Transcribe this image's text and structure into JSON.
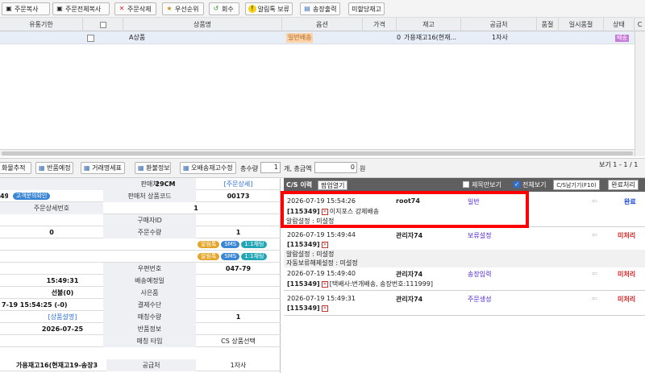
{
  "toolbar": {
    "buttons": [
      {
        "label": "주문복사",
        "icon": "copy-icon"
      },
      {
        "label": "주문전체복사",
        "icon": "copy-all-icon"
      },
      {
        "label": "주문삭제",
        "icon": "delete-icon"
      },
      {
        "label": "우선순위",
        "icon": "priority-icon"
      },
      {
        "label": "회수",
        "icon": "recall-icon"
      },
      {
        "label": "알림톡 보류",
        "icon": "alert-icon"
      },
      {
        "label": "송장출력",
        "icon": "print-icon"
      },
      {
        "label": "미할당재고",
        "icon": ""
      }
    ]
  },
  "grid": {
    "headers": [
      "유통기한",
      "",
      "상품명",
      "옵션",
      "가격",
      "재고",
      "공급처",
      "품절",
      "일시품절",
      "상태",
      "C"
    ],
    "row": {
      "product": "A상품",
      "option": "일반배송",
      "price": "",
      "stock": "0",
      "stock_name": "가용재고16(현재...",
      "supplier": "1자사",
      "status": "배송"
    }
  },
  "lowerbar": {
    "buttons": [
      "화물추적",
      "반품예정",
      "거래명세표",
      "환불정보",
      "오배송재고수정"
    ],
    "total_qty_label": "총수량",
    "total_qty": "1",
    "count_label": "개, 총금액",
    "total_amount": "0",
    "won": "원",
    "paging": "보기 1 - 1 / 1"
  },
  "detail": {
    "rows": [
      {
        "l2": "판매처",
        "v2": "29CM",
        "l3": "",
        "v3": "[주문상세]"
      },
      {
        "v1": "49",
        "chip1": "고객문의확인",
        "l2": "판매처 상품코드",
        "v3": "00173"
      },
      {
        "l1": "주문상세번호",
        "v3": "1"
      },
      {
        "l2": "구매자ID"
      },
      {
        "v1": "0",
        "l2": "주문수량",
        "v3": "1"
      },
      {
        "chips": [
          "알림톡",
          "SMS",
          "1:1채팅"
        ]
      },
      {
        "chips": [
          "알림톡",
          "SMS",
          "1:1채팅"
        ]
      },
      {
        "l2": "우편번호",
        "v3": "047-79"
      },
      {
        "v1": "15:49:31",
        "l2": "배송예정일"
      },
      {
        "v1": "선불(0)",
        "l2": "사은품"
      },
      {
        "v1": "7-19 15:54:25 (-0)",
        "l2": "결제수단"
      },
      {
        "v1": "[상품설명]",
        "l2": "매칭수량",
        "v3": "1"
      },
      {
        "v1": "2026-07-25",
        "l2": "반품정보"
      },
      {
        "l2": "매칭 타입",
        "v3": "CS 상품선택"
      },
      {
        "v1": "가용재고16(현재고19-송장3",
        "l2": "공급처",
        "v3": "1자사"
      }
    ]
  },
  "cs": {
    "title": "C/S 이력",
    "popup_label": "팝업열기",
    "only_title_label": "제목만보기",
    "all_view_label": "전체보기",
    "save_button": "C/S남기기(F10)",
    "done_button": "완료처리",
    "entries": [
      {
        "time": "2026-07-19 15:54:26",
        "user": "root74",
        "type": "일반",
        "status": "완료",
        "code": "[115349]",
        "text": "이지포스 강제배송",
        "notes": [
          "알람설정 : 미설정"
        ]
      },
      {
        "time": "2026-07-19 15:49:44",
        "user": "관리자74",
        "type": "보류설정",
        "status": "미처리",
        "code": "[115349]",
        "text": "",
        "notes": [
          "알람설정 : 미설정",
          "자동보류해제설정 : 미설정"
        ]
      },
      {
        "time": "2026-07-19 15:49:40",
        "user": "관리자74",
        "type": "송장입력",
        "status": "미처리",
        "code": "[115349]",
        "text": "[택배사:번개배송, 송장번호:111999]",
        "notes": []
      },
      {
        "time": "2026-07-19 15:49:31",
        "user": "관리자74",
        "type": "주문생성",
        "status": "미처리",
        "code": "[115349]",
        "text": "",
        "notes": []
      }
    ]
  },
  "colors": {
    "accent_red": "#ff0000",
    "link_blue": "#2a6fd6",
    "type_purple": "#4b1fd0",
    "status_red": "#d9211f",
    "status_blue": "#1846d6"
  }
}
